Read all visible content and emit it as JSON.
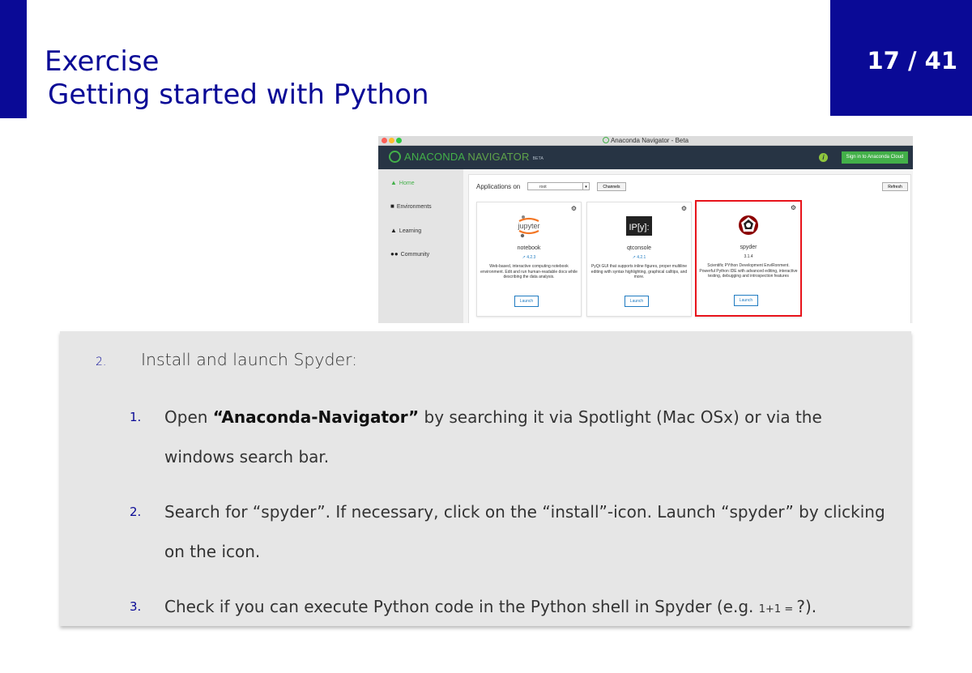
{
  "slide": {
    "title_line1": "Exercise",
    "title_line2": "Getting started with Python",
    "page_number": "17 / 41",
    "accent_color": "#0a0a96"
  },
  "navigator": {
    "window_title": "Anaconda Navigator - Beta",
    "brand_anaconda": "ANACONDA",
    "brand_navigator": " NAVIGATOR",
    "brand_beta": "BETA",
    "signin_label": "Sign in to Anaconda Cloud",
    "sidebar": {
      "home": "Home",
      "environments": "Environments",
      "learning": "Learning",
      "community": "Community"
    },
    "applications_on_label": "Applications on",
    "env_value": "root",
    "channels_label": "Channels",
    "refresh_label": "Refresh",
    "apps": [
      {
        "name": "notebook",
        "version": "↗ 4.2.3",
        "description": "Web-based, interactive computing notebook environment. Edit and run human-readable docs while describing the data analysis.",
        "launch": "Launch",
        "logo_text": "jupyter"
      },
      {
        "name": "qtconsole",
        "version": "↗ 4.2.1",
        "description": "PyQt GUI that supports inline figures, proper multiline editing with syntax highlighting, graphical calltips, and more.",
        "launch": "Launch",
        "logo_text": "IP[y]:"
      },
      {
        "name": "spyder",
        "version": "3.1.4",
        "description": "Scientific PYthon Development EnviRonment. Powerful Python IDE with advanced editing, interactive testing, debugging and introspection features",
        "launch": "Launch"
      }
    ],
    "colors": {
      "header": "#273444",
      "brand_green": "#43b049",
      "highlight_red": "#e8141b",
      "link_blue": "#1f7bc1"
    }
  },
  "instructions": {
    "step_number": "2.",
    "step_text": "Install and launch Spyder:",
    "substeps": [
      {
        "number": "1.",
        "pre": "Open ",
        "bold": "“Anaconda-Navigator”",
        "post": " by searching it via Spotlight (Mac OSx) or via the windows search bar."
      },
      {
        "number": "2.",
        "text": "Search for “spyder”. If necessary, click on the “install”-icon. Launch “spyder” by clicking on the icon."
      },
      {
        "number": "3.",
        "pre": "Check if you can execute Python code in the Python shell in Spyder (e.g. ",
        "small": "1+1 = ",
        "post": "?)."
      }
    ]
  }
}
